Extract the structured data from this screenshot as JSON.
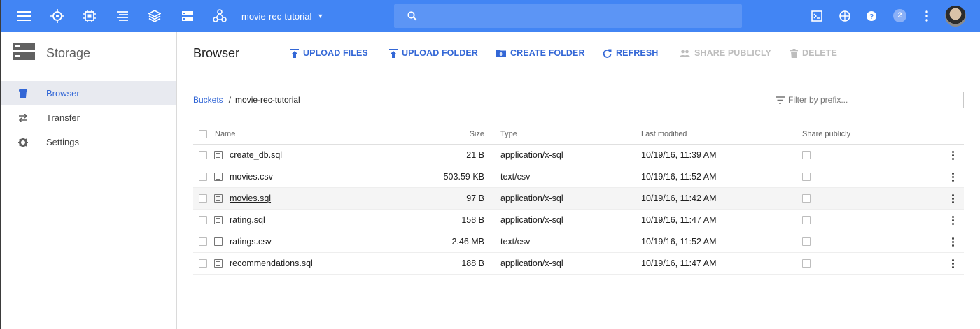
{
  "topbar": {
    "project_name": "movie-rec-tutorial",
    "notification_count": "2",
    "icons": [
      "menu-icon",
      "dashboard-icon",
      "compute-icon",
      "logs-icon",
      "layers-icon",
      "storage-icon",
      "network-icon",
      "search-icon",
      "cloud-shell-icon",
      "notifications-icon",
      "help-icon",
      "more-vert-icon"
    ],
    "color": "#4285f4"
  },
  "sidebar": {
    "title": "Storage",
    "items": [
      {
        "label": "Browser",
        "icon": "bucket-icon",
        "active": true
      },
      {
        "label": "Transfer",
        "icon": "transfer-icon",
        "active": false
      },
      {
        "label": "Settings",
        "icon": "gear-icon",
        "active": false
      }
    ]
  },
  "main": {
    "title": "Browser",
    "actions": {
      "upload_files": "UPLOAD FILES",
      "upload_folder": "UPLOAD FOLDER",
      "create_folder": "CREATE FOLDER",
      "refresh": "REFRESH",
      "share_publicly": "SHARE PUBLICLY",
      "delete": "DELETE"
    },
    "breadcrumb": {
      "root": "Buckets",
      "separator": "/",
      "current": "movie-rec-tutorial"
    },
    "filter": {
      "placeholder": "Filter by prefix..."
    },
    "columns": {
      "name": "Name",
      "size": "Size",
      "type": "Type",
      "modified": "Last modified",
      "share": "Share publicly"
    },
    "rows": [
      {
        "name": "create_db.sql",
        "size": "21 B",
        "type": "application/x-sql",
        "modified": "10/19/16, 11:39 AM"
      },
      {
        "name": "movies.csv",
        "size": "503.59 KB",
        "type": "text/csv",
        "modified": "10/19/16, 11:52 AM"
      },
      {
        "name": "movies.sql",
        "size": "97 B",
        "type": "application/x-sql",
        "modified": "10/19/16, 11:42 AM"
      },
      {
        "name": "rating.sql",
        "size": "158 B",
        "type": "application/x-sql",
        "modified": "10/19/16, 11:47 AM"
      },
      {
        "name": "ratings.csv",
        "size": "2.46 MB",
        "type": "text/csv",
        "modified": "10/19/16, 11:52 AM"
      },
      {
        "name": "recommendations.sql",
        "size": "188 B",
        "type": "application/x-sql",
        "modified": "10/19/16, 11:47 AM"
      }
    ]
  }
}
